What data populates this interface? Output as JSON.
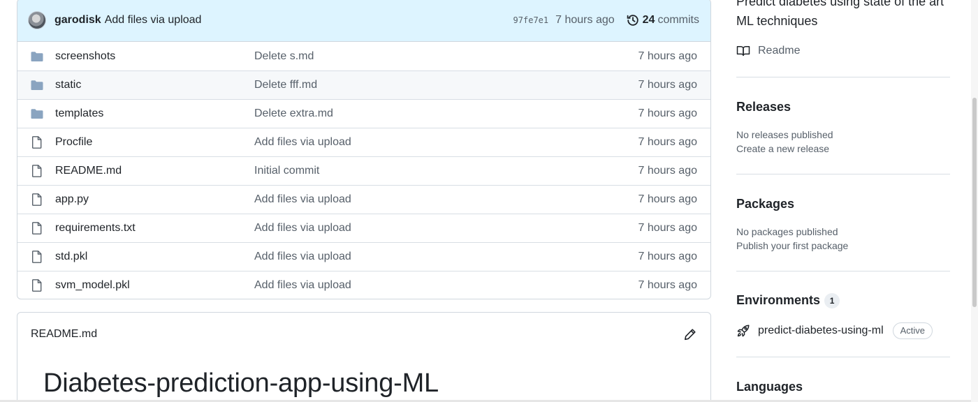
{
  "commit": {
    "author": "garodisk",
    "message": "Add files via upload",
    "sha": "97fe7e1",
    "time": "7 hours ago",
    "count": "24",
    "count_label": "commits"
  },
  "files": [
    {
      "name": "screenshots",
      "type": "folder",
      "commit": "Delete s.md",
      "time": "7 hours ago"
    },
    {
      "name": "static",
      "type": "folder",
      "commit": "Delete fff.md",
      "time": "7 hours ago"
    },
    {
      "name": "templates",
      "type": "folder",
      "commit": "Delete extra.md",
      "time": "7 hours ago"
    },
    {
      "name": "Procfile",
      "type": "file",
      "commit": "Add files via upload",
      "time": "7 hours ago"
    },
    {
      "name": "README.md",
      "type": "file",
      "commit": "Initial commit",
      "time": "7 hours ago"
    },
    {
      "name": "app.py",
      "type": "file",
      "commit": "Add files via upload",
      "time": "7 hours ago"
    },
    {
      "name": "requirements.txt",
      "type": "file",
      "commit": "Add files via upload",
      "time": "7 hours ago"
    },
    {
      "name": "std.pkl",
      "type": "file",
      "commit": "Add files via upload",
      "time": "7 hours ago"
    },
    {
      "name": "svm_model.pkl",
      "type": "file",
      "commit": "Add files via upload",
      "time": "7 hours ago"
    }
  ],
  "readme": {
    "filename": "README.md",
    "heading": "Diabetes-prediction-app-using-ML"
  },
  "sidebar": {
    "about_desc": "Predict diabetes using state of the art ML techniques",
    "readme_link": "Readme",
    "releases": {
      "heading": "Releases",
      "empty": "No releases published",
      "action": "Create a new release"
    },
    "packages": {
      "heading": "Packages",
      "empty": "No packages published",
      "action": "Publish your first package"
    },
    "environments": {
      "heading": "Environments",
      "count": "1",
      "name": "predict-diabetes-using-ml",
      "status": "Active"
    },
    "languages": {
      "heading": "Languages"
    }
  },
  "colors": {
    "commit_bar_bg": "#ddf4ff",
    "folder_icon": "#8aa4c0",
    "text_muted": "#57606a",
    "border": "#d0d7de"
  }
}
